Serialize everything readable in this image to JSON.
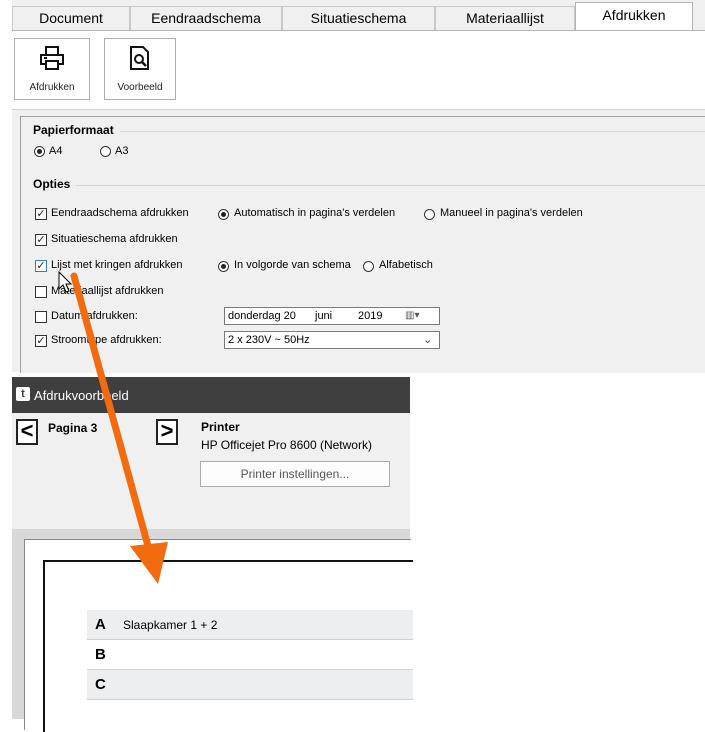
{
  "tabs": [
    "Document",
    "Eendraadschema",
    "Situatieschema",
    "Materiaallijst",
    "Afdrukken"
  ],
  "toolbar": {
    "print_label": "Afdrukken",
    "preview_label": "Voorbeeld"
  },
  "paper_section": {
    "title": "Papierformaat",
    "options": [
      "A4",
      "A3"
    ],
    "selected": "A4"
  },
  "options_section": {
    "title": "Opties",
    "eendraad": {
      "label": "Eendraadschema afdrukken",
      "checked": true,
      "radio_auto": "Automatisch in pagina's verdelen",
      "radio_manual": "Manueel in pagina's verdelen"
    },
    "situatie": {
      "label": "Situatieschema afdrukken",
      "checked": true
    },
    "kringen": {
      "label": "Lijst met kringen afdrukken",
      "checked": true,
      "radio_order": "In volgorde van schema",
      "radio_alpha": "Alfabetisch"
    },
    "materiaal": {
      "label": "Materiaallijst afdrukken",
      "checked": false
    },
    "datum": {
      "label": "Datum afdrukken:",
      "checked": false,
      "day": "donderdag 20",
      "month": "juni",
      "year": "2019"
    },
    "stroom": {
      "label": "Stroomtype afdrukken:",
      "checked": true,
      "value": "2 x 230V ~ 50Hz"
    }
  },
  "preview": {
    "app_icon": "t",
    "title": "Afdrukvoorbeeld",
    "prev_glyph": "<",
    "next_glyph": ">",
    "page_label": "Pagina 3",
    "printer_heading": "Printer",
    "printer_name": "HP Officejet Pro 8600 (Network)",
    "printer_settings_button": "Printer instellingen...",
    "rows": [
      {
        "key": "A",
        "value": "Slaapkamer 1 + 2"
      },
      {
        "key": "B",
        "value": ""
      },
      {
        "key": "C",
        "value": ""
      }
    ]
  },
  "colors": {
    "arrow": "#f26b0f",
    "title_bar": "#3f3f3f",
    "panel": "#f0f0f0"
  }
}
